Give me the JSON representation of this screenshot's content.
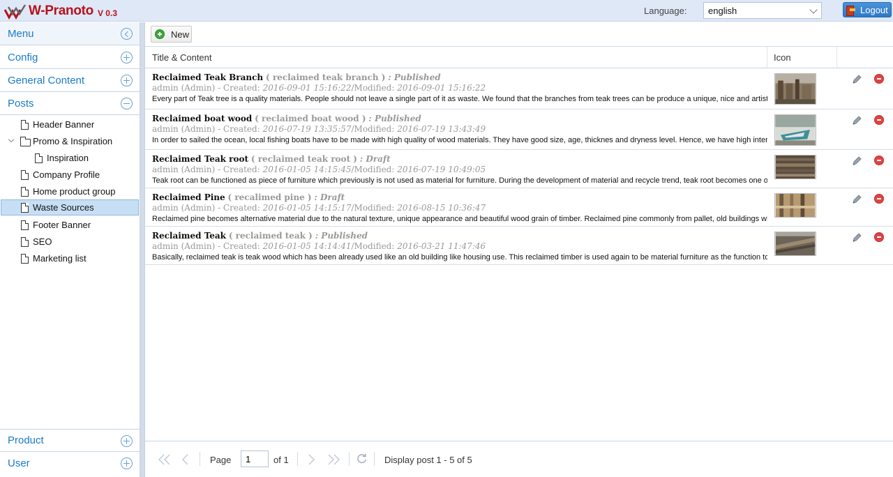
{
  "app": {
    "name": "W-Pranoto",
    "version": "V 0.3"
  },
  "header": {
    "language_label": "Language:",
    "language_value": "english",
    "logout_label": "Logout"
  },
  "sidebar": {
    "menu_label": "Menu",
    "sections": [
      {
        "label": "Config"
      },
      {
        "label": "General Content"
      },
      {
        "label": "Posts"
      },
      {
        "label": "Product"
      },
      {
        "label": "User"
      }
    ],
    "tree": [
      {
        "label": "Header Banner"
      },
      {
        "label": "Promo & Inspiration"
      },
      {
        "label": "Inspiration"
      },
      {
        "label": "Company Profile"
      },
      {
        "label": "Home product group"
      },
      {
        "label": "Waste Sources"
      },
      {
        "label": "Footer Banner"
      },
      {
        "label": "SEO"
      },
      {
        "label": "Marketing list"
      }
    ]
  },
  "toolbar": {
    "new_label": "New"
  },
  "grid": {
    "columns": [
      "Title & Content",
      "Icon"
    ],
    "rows": [
      {
        "title": "Reclaimed Teak Branch",
        "slug": "( reclaimed teak branch )",
        "status": ": Published",
        "author": "admin (Admin) - Created:",
        "created": "2016-09-01 15:16:22",
        "modified_label": "/Modified:",
        "modified": "2016-09-01 15:16:22",
        "body": "Every part of Teak tree is a quality materials. People should not leave a single part of it as waste. We found that the branches from teak trees can be produce a unique, nice and artistic"
      },
      {
        "title": "Reclaimed boat wood",
        "slug": "( reclaimed boat wood )",
        "status": ": Published",
        "author": "admin (Admin) - Created:",
        "created": "2016-07-19 13:35:57",
        "modified_label": "/Modified:",
        "modified": "2016-07-19 13:43:49",
        "body": "In order to sailed the ocean, local fishing boats have to be made with high quality of wood materials. They have good size, age, thicknes and dryness level. Hence, we have high interest"
      },
      {
        "title": "Reclaimed Teak root",
        "slug": "( reclaimed teak root )",
        "status": ": Draft",
        "author": "admin (Admin) - Created:",
        "created": "2016-01-05 14:15:45",
        "modified_label": "/Modified:",
        "modified": "2016-07-19 10:49:05",
        "body": "Teak root can be functioned as piece of furniture which previously is not used as material for furniture. During the development of material and recycle trend, teak root becomes one of"
      },
      {
        "title": "Reclaimed Pine",
        "slug": "( recalimed pine )",
        "status": ": Draft",
        "author": "admin (Admin) - Created:",
        "created": "2016-01-05 14:15:17",
        "modified_label": "/Modified:",
        "modified": "2016-08-15 10:36:47",
        "body": "Reclaimed pine becomes alternative material due to the natural texture, unique appearance and beautiful wood grain of timber. Reclaimed pine commonly from pallet, old buildings which"
      },
      {
        "title": "Reclaimed Teak",
        "slug": "( reclaimed teak )",
        "status": ": Published",
        "author": "admin (Admin) - Created:",
        "created": "2016-01-05 14:14:41",
        "modified_label": "/Modified:",
        "modified": "2016-03-21 11:47:46",
        "body": "Basically, reclaimed teak is teak wood which has been already used like an old building like housing use. This reclaimed timber is used again to be material furniture as the function to sa"
      }
    ]
  },
  "pager": {
    "page_label": "Page",
    "page_value": "1",
    "of_label": "of 1",
    "display_text": "Display post 1 - 5 of 5"
  },
  "colors": {
    "brand": "#b5121b",
    "accent": "#1a7bc9",
    "selected": "#c7dff4"
  }
}
